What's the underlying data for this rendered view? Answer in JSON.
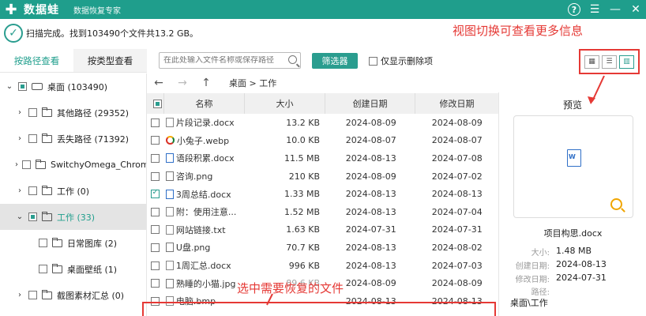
{
  "app": {
    "name": "数据蛙",
    "subtitle": "数据恢复专家",
    "logo_glyph": "✚"
  },
  "window_controls": {
    "help": "?",
    "menu": "☰",
    "minimize": "—",
    "close": "✕"
  },
  "status": {
    "text": "扫描完成。找到103490个文件共13.2 GB。"
  },
  "annotations": {
    "view_switch": "视图切换可查看更多信息",
    "select_files": "选中需要恢复的文件"
  },
  "left_tabs": {
    "by_path": "按路径查看",
    "by_type": "按类型查看"
  },
  "tree": [
    {
      "label": "桌面 (103490)",
      "chevron": "⌄",
      "check": "partial",
      "icon": "drive",
      "indent": 0
    },
    {
      "label": "其他路径 (29352)",
      "chevron": "›",
      "check": "none",
      "icon": "folder",
      "indent": 1
    },
    {
      "label": "丢失路径 (71392)",
      "chevron": "›",
      "check": "none",
      "icon": "folder",
      "indent": 1
    },
    {
      "label": "SwitchyOmega_Chromium",
      "chevron": "›",
      "check": "none",
      "icon": "folder",
      "indent": 1
    },
    {
      "label": "工作 (0)",
      "chevron": "›",
      "check": "none",
      "icon": "folder",
      "indent": 1
    },
    {
      "label": "工作 (33)",
      "chevron": "⌄",
      "check": "partial",
      "icon": "folder",
      "indent": 1,
      "selected": true
    },
    {
      "label": "日常图库 (2)",
      "chevron": "",
      "check": "none",
      "icon": "folder",
      "indent": 2
    },
    {
      "label": "桌面壁纸 (1)",
      "chevron": "",
      "check": "none",
      "icon": "folder",
      "indent": 2
    },
    {
      "label": "截图素材汇总 (0)",
      "chevron": "›",
      "check": "none",
      "icon": "folder",
      "indent": 1
    }
  ],
  "search": {
    "placeholder": "在此处输入文件名称或保存路径"
  },
  "toolbar": {
    "filter_label": "筛选器",
    "show_deleted_label": "仅显示删除项"
  },
  "view_buttons": [
    {
      "name": "grid",
      "glyph": "▦",
      "active": false
    },
    {
      "name": "list",
      "glyph": "☰",
      "active": false
    },
    {
      "name": "detail",
      "glyph": "▥",
      "active": true
    }
  ],
  "nav": {
    "back": "←",
    "forward": "→",
    "up": "↑",
    "breadcrumb": "桌面 > 工作"
  },
  "table": {
    "headers": {
      "name": "名称",
      "size": "大小",
      "created": "创建日期",
      "modified": "修改日期"
    },
    "rows": [
      {
        "name": "片段记录.docx",
        "size": "13.2 KB",
        "created": "2024-08-09",
        "modified": "2024-08-09",
        "icon": "file",
        "checked": false
      },
      {
        "name": "小兔子.webp",
        "size": "10.0 KB",
        "created": "2024-08-07",
        "modified": "2024-08-07",
        "icon": "chrome",
        "checked": false
      },
      {
        "name": "语段积累.docx",
        "size": "11.5 MB",
        "created": "2024-08-13",
        "modified": "2024-07-08",
        "icon": "word",
        "checked": false
      },
      {
        "name": "咨询.png",
        "size": "210 KB",
        "created": "2024-08-09",
        "modified": "2024-07-02",
        "icon": "image",
        "checked": false
      },
      {
        "name": "3周总结.docx",
        "size": "1.33 MB",
        "created": "2024-08-13",
        "modified": "2024-08-13",
        "icon": "word",
        "checked": true
      },
      {
        "name": "附：使用注意...",
        "size": "1.52 MB",
        "created": "2024-08-13",
        "modified": "2024-07-04",
        "icon": "file",
        "checked": false
      },
      {
        "name": "网站链接.txt",
        "size": "1.63 KB",
        "created": "2024-07-31",
        "modified": "2024-07-31",
        "icon": "file",
        "checked": false
      },
      {
        "name": "U盘.png",
        "size": "70.7 KB",
        "created": "2024-08-13",
        "modified": "2024-08-02",
        "icon": "image",
        "checked": false
      },
      {
        "name": "1周汇总.docx",
        "size": "996 KB",
        "created": "2024-08-13",
        "modified": "2024-07-03",
        "icon": "file",
        "checked": false
      },
      {
        "name": "熟睡的小猫.jpg",
        "size": "89.6 KB",
        "created": "2024-08-09",
        "modified": "2024-08-09",
        "icon": "image",
        "checked": false
      },
      {
        "name": "电脑.bmp",
        "size": "",
        "created": "2024-08-13",
        "modified": "2024-08-13",
        "icon": "file",
        "checked": false
      }
    ]
  },
  "preview": {
    "title": "预览",
    "file_name": "项目构思.docx",
    "size_label": "大小:",
    "size_value": "1.48 MB",
    "created_label": "创建日期:",
    "created_value": "2024-08-13",
    "modified_label": "修改日期:",
    "modified_value": "2024-07-31",
    "path_label": "路径:",
    "path_value": "桌面\\工作"
  },
  "colors": {
    "brand": "#1f9e8c",
    "annotation": "#e53935"
  }
}
